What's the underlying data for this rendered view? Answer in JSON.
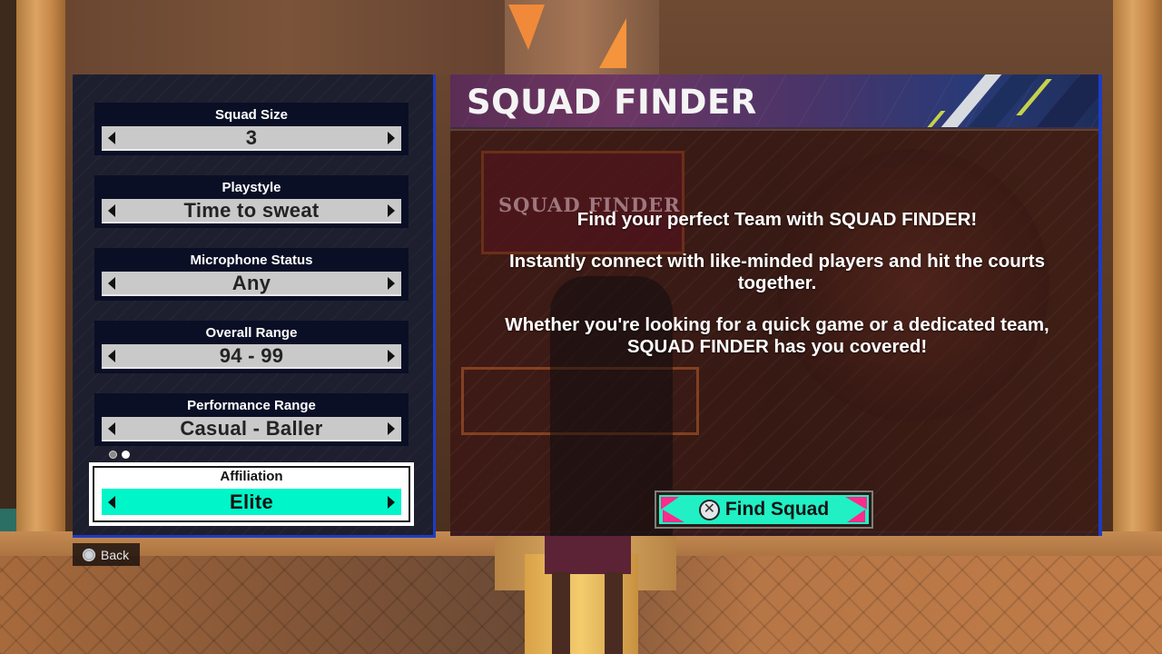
{
  "filters": [
    {
      "label": "Squad Size",
      "value": "3"
    },
    {
      "label": "Playstyle",
      "value": "Time to sweat"
    },
    {
      "label": "Microphone Status",
      "value": "Any"
    },
    {
      "label": "Overall Range",
      "value": "94 - 99"
    },
    {
      "label": "Performance Range",
      "value": "Casual - Baller"
    },
    {
      "label": "Affiliation",
      "value": "Elite",
      "selected": true
    }
  ],
  "pagination": {
    "pages": 2,
    "current": 2
  },
  "back": {
    "label": "Back",
    "icon": "circle-button-icon"
  },
  "info": {
    "title": "SQUAD FINDER",
    "background_sign": "SQUAD FINDER",
    "paragraphs": [
      "Find your perfect Team with SQUAD FINDER!",
      "Instantly connect with like-minded players and hit the courts together.",
      "Whether you're looking for a quick game or a dedicated team, SQUAD FINDER has you covered!"
    ],
    "action": {
      "label": "Find Squad",
      "icon": "cross-button-icon"
    }
  },
  "colors": {
    "accent_teal": "#00f5c8",
    "panel_border_blue": "#1c3cc4",
    "bolt_pink": "#ff2a8a"
  }
}
